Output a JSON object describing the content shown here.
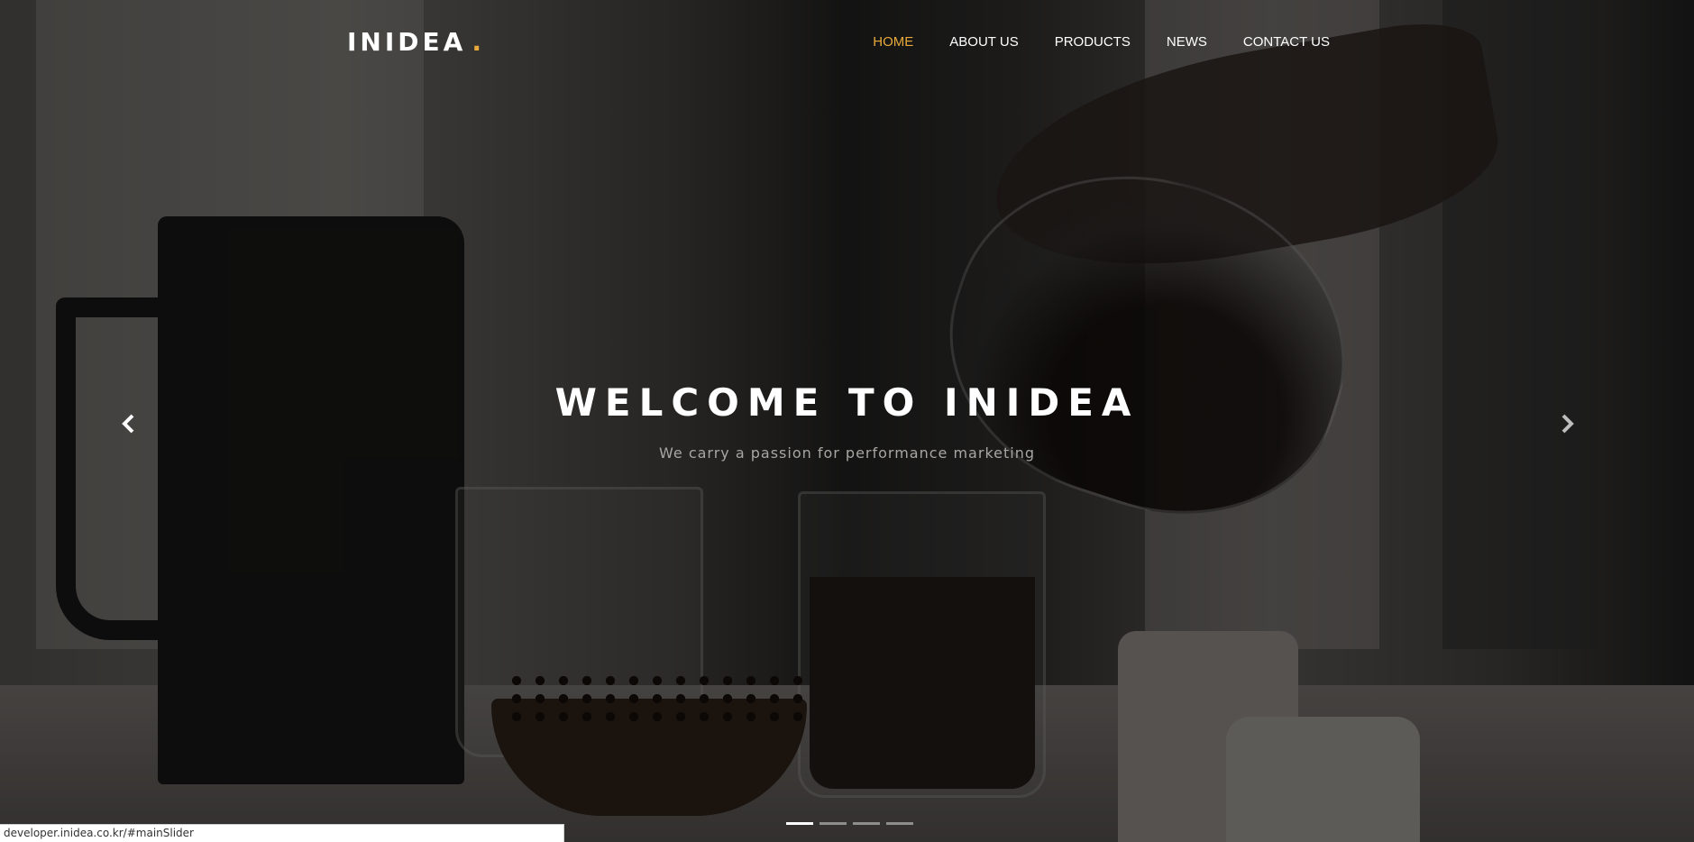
{
  "header": {
    "logo_text": "INIDEA",
    "logo_dot": ".",
    "nav": [
      {
        "label": "HOME",
        "active": true
      },
      {
        "label": "ABOUT US",
        "active": false
      },
      {
        "label": "PRODUCTS",
        "active": false
      },
      {
        "label": "NEWS",
        "active": false
      },
      {
        "label": "CONTACT US",
        "active": false
      }
    ]
  },
  "slider": {
    "headline": "WELCOME TO INIDEA",
    "subheadline": "We carry a passion for performance marketing",
    "prev_icon": "chevron-left-icon",
    "next_icon": "chevron-right-icon",
    "slide_count": 4,
    "active_slide": 1
  },
  "status_bar": {
    "url": "developer.inidea.co.kr/#mainSlider"
  },
  "colors": {
    "accent": "#e8a93b",
    "text_primary": "#ffffff",
    "text_muted": "#a8a6a3"
  }
}
